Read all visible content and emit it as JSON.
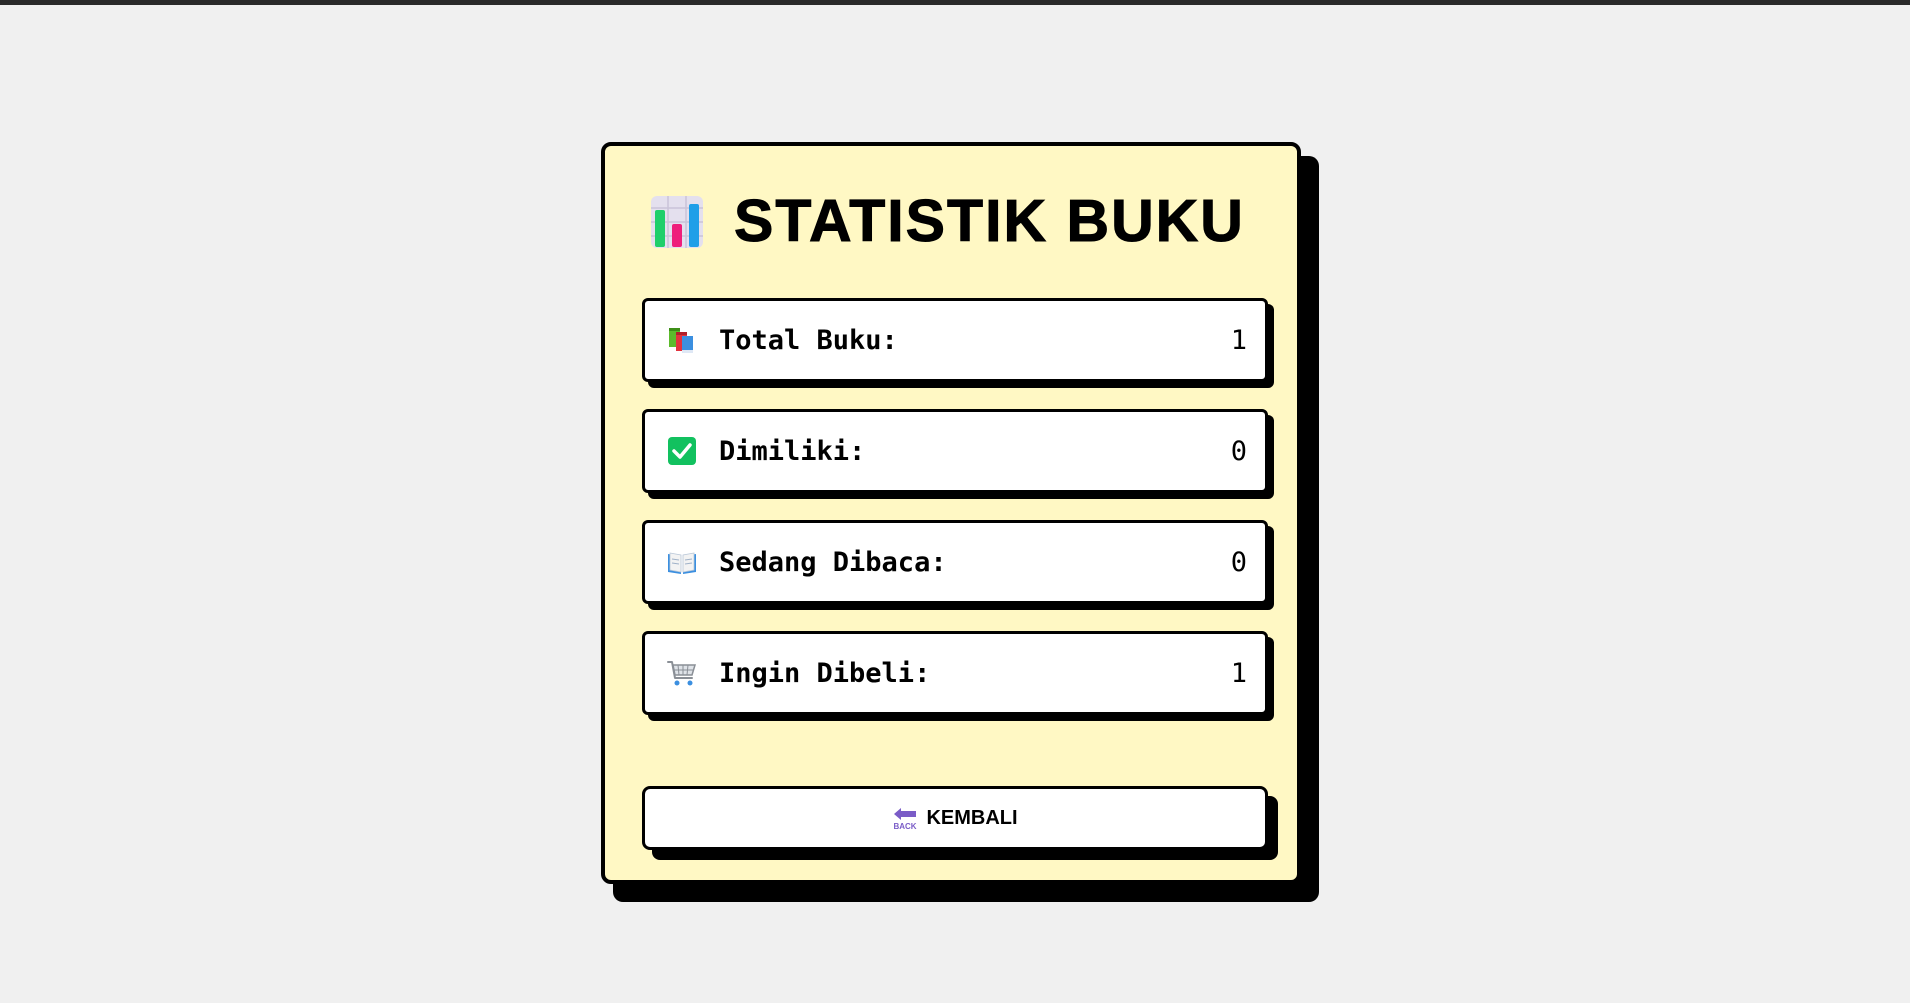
{
  "header": {
    "title": "STATISTIK BUKU",
    "icon": "bar-chart-icon"
  },
  "stats": [
    {
      "icon": "books-icon",
      "label": "Total Buku:",
      "value": "1"
    },
    {
      "icon": "check-mark-icon",
      "label": "Dimiliki:",
      "value": "0"
    },
    {
      "icon": "open-book-icon",
      "label": "Sedang Dibaca:",
      "value": "0"
    },
    {
      "icon": "shopping-cart-icon",
      "label": "Ingin Dibeli:",
      "value": "1"
    }
  ],
  "back_button": {
    "icon": "back-arrow-icon",
    "icon_text": "BACK",
    "label": "KEMBALI"
  },
  "colors": {
    "page_background": "#f0f0f0",
    "card_background": "#fff8c4",
    "border": "#000000",
    "row_background": "#ffffff",
    "check_green": "#12c15f",
    "back_purple": "#7a5cc7"
  }
}
